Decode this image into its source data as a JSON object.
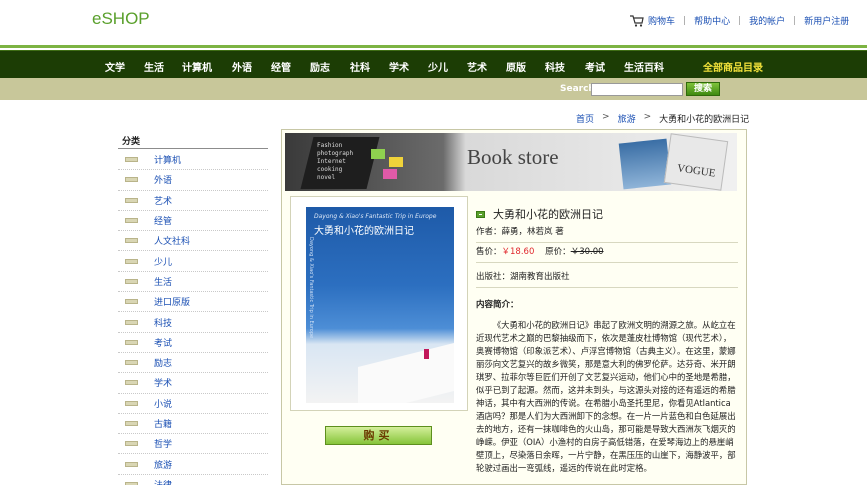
{
  "header": {
    "logo": "eSHOP",
    "links": [
      "购物车",
      "帮助中心",
      "我的帐户",
      "新用户注册"
    ]
  },
  "nav": {
    "items": [
      "文学",
      "生活",
      "计算机",
      "外语",
      "经管",
      "励志",
      "社科",
      "学术",
      "少儿",
      "艺术",
      "原版",
      "科技",
      "考试",
      "生活百科"
    ],
    "all_products": "全部商品目录"
  },
  "search": {
    "label": "Search",
    "value": "",
    "button": "搜索"
  },
  "breadcrumb": {
    "home": "首页",
    "category": "旅游",
    "current": "大勇和小花的欧洲日记"
  },
  "sidebar": {
    "title": "分类",
    "categories": [
      "计算机",
      "外语",
      "艺术",
      "经管",
      "人文社科",
      "少儿",
      "生活",
      "进口原版",
      "科技",
      "考试",
      "励志",
      "学术",
      "小说",
      "古籍",
      "哲学",
      "旅游",
      "法律"
    ]
  },
  "banner": {
    "headline": "Book store",
    "screen_text": [
      "Fashion",
      "photograph",
      "Internet",
      "cooking",
      "novel"
    ],
    "magazine": "VOGUE"
  },
  "book": {
    "cover_title_en": "Dayong & Xiao's Fantastic Trip in Europe",
    "cover_title_cn": "大勇和小花的欧洲日记",
    "title": "大勇和小花的欧洲日记",
    "author_label": "作者：",
    "author": "薛勇，林若岚 著",
    "price_label": "售价：",
    "price": "￥18.60",
    "orig_label": "原价：",
    "orig_price": "￥30.00",
    "publisher_label": "出版社：",
    "publisher": "湖南教育出版社",
    "intro_label": "内容简介：",
    "description": "《大勇和小花的欧洲日记》串起了欧洲文明的溯源之旅。从屹立在近现代艺术之巅的巴黎抽级而下，依次是蓬皮杜博物馆（现代艺术），奥赛博物馆（印象派艺术）、卢浮宫博物馆（古典主义）。在这里，蒙娜丽莎向文艺复兴的故乡微笑，那是意大利的佛罗伦萨。达芬奇、米开朗琪罗、拉菲尔等巨匠们开创了文艺复兴运动，他们心中的圣地是希腊，似乎已到了起源。然而，这并未到头，与这源头对接的还有遥远的希腊神话，其中有大西洲的传说。在希腊小岛圣托里尼，你看见Atlantica酒店吗？那是人们为大西洲卸下的念想。在一片一片蓝色和白色延展出去的地方，还有一抹咖啡色的火山岛，那可能是导致大西洲灰飞烟灭的峥嵘。伊亚（OIA）小渔村的白房子高低错落，在爱琴海边上的悬崖峭壁顶上，尽染落日余晖，一片宁静，在黑压压的山崖下，海静波平，部轮驶过画出一弯弧线，遥远的传说在此时定格。",
    "buy_button": "购买"
  }
}
